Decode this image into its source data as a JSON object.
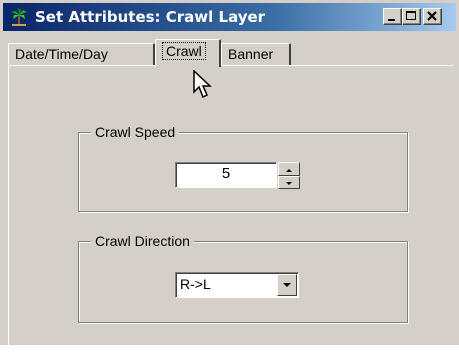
{
  "window": {
    "title": "Set Attributes: Crawl Layer",
    "app_icon": "palm-tree-icon",
    "controls": [
      "minimize-icon",
      "maximize-icon",
      "close-icon"
    ]
  },
  "tabs": [
    {
      "label": "Date/Time/Day",
      "active": false
    },
    {
      "label": "Crawl",
      "active": true
    },
    {
      "label": "Banner",
      "active": false
    }
  ],
  "crawl_speed": {
    "label": "Crawl Speed",
    "value": "5"
  },
  "crawl_direction": {
    "label": "Crawl Direction",
    "selected": "R->L"
  }
}
